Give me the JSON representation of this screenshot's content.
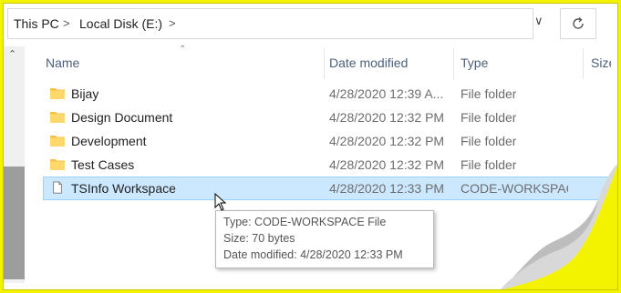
{
  "address_bar": {
    "crumbs": [
      "This PC",
      "Local Disk (E:)"
    ],
    "separator": ">",
    "dropdown": "∨",
    "refresh_icon": "refresh-icon"
  },
  "nav": {
    "scroll_up": "⌃"
  },
  "columns": {
    "name": "Name",
    "date": "Date modified",
    "type": "Type",
    "size": "Size"
  },
  "files": [
    {
      "name": "Bijay",
      "date": "4/28/2020 12:39 A...",
      "type": "File folder",
      "icon": "folder-icon"
    },
    {
      "name": "Design Document",
      "date": "4/28/2020 12:32 PM",
      "type": "File folder",
      "icon": "folder-icon"
    },
    {
      "name": "Development",
      "date": "4/28/2020 12:32 PM",
      "type": "File folder",
      "icon": "folder-icon"
    },
    {
      "name": "Test Cases",
      "date": "4/28/2020 12:32 PM",
      "type": "File folder",
      "icon": "folder-icon"
    },
    {
      "name": "TSInfo Workspace",
      "date": "4/28/2020 12:33 PM",
      "type": "CODE-WORKSPACE",
      "icon": "file-icon"
    }
  ],
  "tooltip": {
    "type": "Type: CODE-WORKSPACE File",
    "size": "Size: 70 bytes",
    "modified": "Date modified: 4/28/2020 12:33 PM"
  },
  "colors": {
    "frame_border": "#f3f300",
    "selection_fill": "#cce8ff",
    "selection_border": "#99d1ff",
    "folder": "#f4c046"
  }
}
